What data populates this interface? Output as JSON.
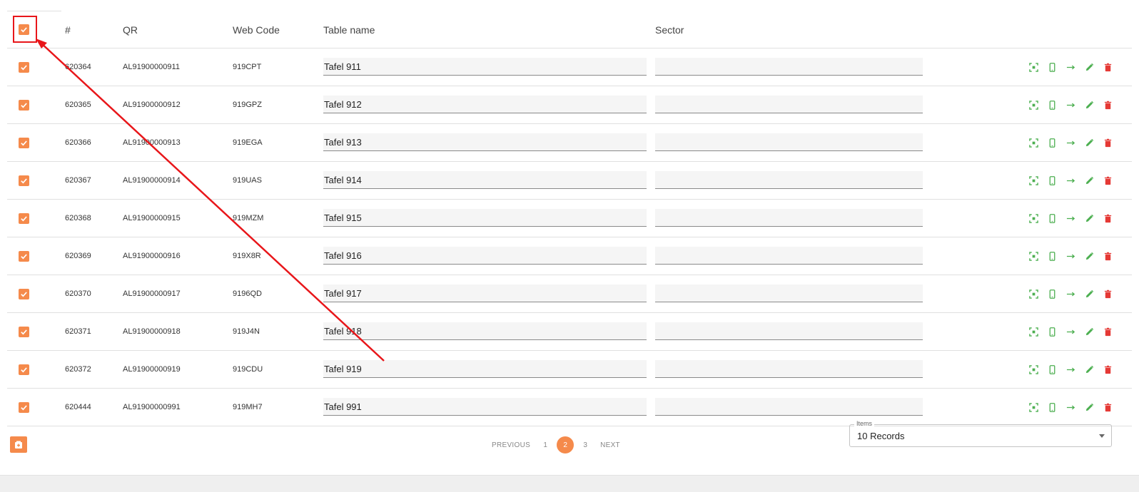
{
  "header": {
    "col_num": "#",
    "col_qr": "QR",
    "col_web": "Web Code",
    "col_name": "Table name",
    "col_sector": "Sector"
  },
  "rows": [
    {
      "num": "620364",
      "qr": "AL91900000911",
      "web": "919CPT",
      "name": "Tafel 911",
      "sector": ""
    },
    {
      "num": "620365",
      "qr": "AL91900000912",
      "web": "919GPZ",
      "name": "Tafel 912",
      "sector": ""
    },
    {
      "num": "620366",
      "qr": "AL91900000913",
      "web": "919EGA",
      "name": "Tafel 913",
      "sector": ""
    },
    {
      "num": "620367",
      "qr": "AL91900000914",
      "web": "919UAS",
      "name": "Tafel 914",
      "sector": ""
    },
    {
      "num": "620368",
      "qr": "AL91900000915",
      "web": "919MZM",
      "name": "Tafel 915",
      "sector": ""
    },
    {
      "num": "620369",
      "qr": "AL91900000916",
      "web": "919X8R",
      "name": "Tafel 916",
      "sector": ""
    },
    {
      "num": "620370",
      "qr": "AL91900000917",
      "web": "9196QD",
      "name": "Tafel 917",
      "sector": ""
    },
    {
      "num": "620371",
      "qr": "AL91900000918",
      "web": "919J4N",
      "name": "Tafel 918",
      "sector": ""
    },
    {
      "num": "620372",
      "qr": "AL91900000919",
      "web": "919CDU",
      "name": "Tafel 919",
      "sector": ""
    },
    {
      "num": "620444",
      "qr": "AL91900000991",
      "web": "919MH7",
      "name": "Tafel 991",
      "sector": ""
    }
  ],
  "actions": {
    "icons": [
      "qr-scan-icon",
      "phone-icon",
      "arrow-right-icon",
      "edit-pencil-icon",
      "delete-trash-icon"
    ]
  },
  "pagination": {
    "previous_label": "PREVIOUS",
    "next_label": "NEXT",
    "pages": [
      "1",
      "2",
      "3"
    ],
    "current_page": "2"
  },
  "items_select": {
    "label": "Items",
    "value": "10 Records"
  },
  "colors": {
    "accent": "#f58a4b",
    "action_green": "#4caf50",
    "delete_red": "#e53935",
    "annotation_red": "#e8161a"
  }
}
